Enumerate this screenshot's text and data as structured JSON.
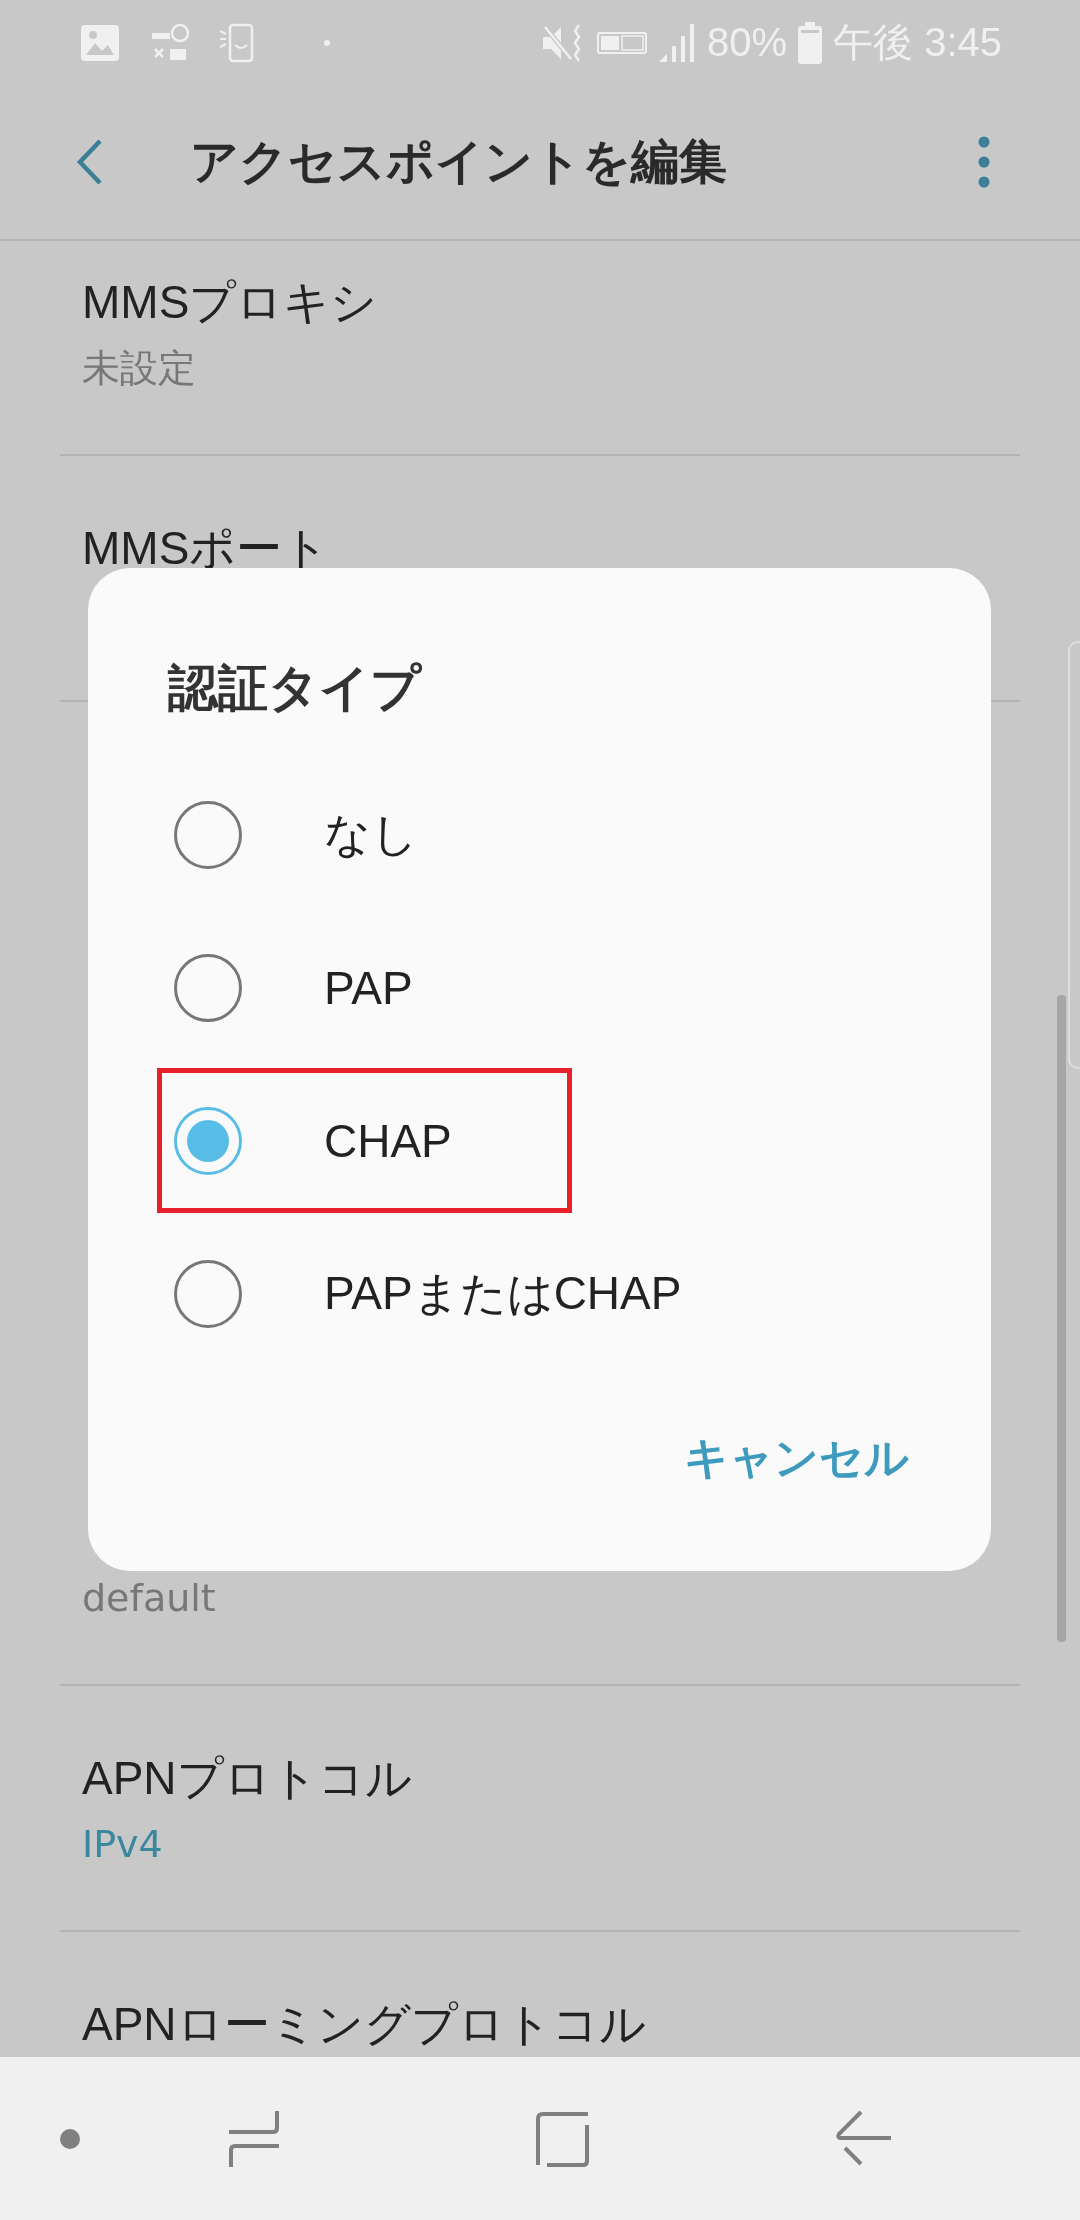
{
  "status_bar": {
    "battery": "80%",
    "time": "午後 3:45"
  },
  "app_bar": {
    "title": "アクセスポイントを編集"
  },
  "settings_top": [
    {
      "title": "MMSプロキシ",
      "value": "未設定",
      "kind": "muted"
    },
    {
      "title": "MMSポート"
    }
  ],
  "settings_bottom": [
    {
      "value": "default",
      "kind": "muted"
    },
    {
      "title": "APNプロトコル",
      "value": "IPv4",
      "kind": "accent"
    },
    {
      "title": "APNローミングプロトコル"
    }
  ],
  "dialog": {
    "title": "認証タイプ",
    "options": [
      {
        "label": "なし",
        "selected": false,
        "highlighted": false
      },
      {
        "label": "PAP",
        "selected": false,
        "highlighted": false
      },
      {
        "label": "CHAP",
        "selected": true,
        "highlighted": true
      },
      {
        "label": "PAPまたはCHAP",
        "selected": false,
        "highlighted": false
      }
    ],
    "cancel": "キャンセル"
  }
}
